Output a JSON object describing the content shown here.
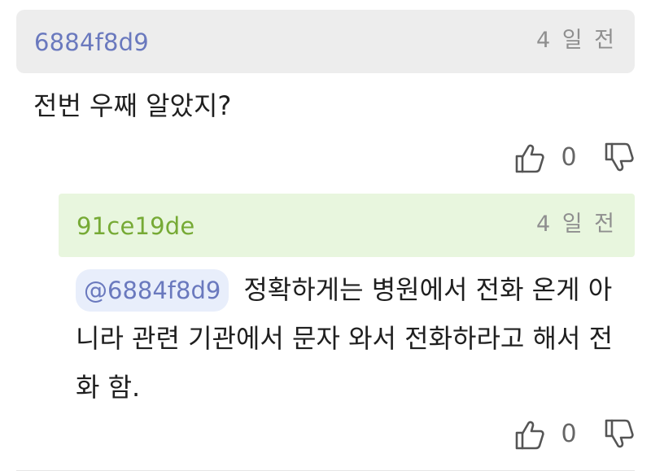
{
  "comment": {
    "author": "6884f8d9",
    "time": "4 일 전",
    "text": "전번 우째 알았지?",
    "likes": "0",
    "icons": {
      "like": "thumbs-up-icon",
      "dislike": "thumbs-down-icon"
    }
  },
  "reply": {
    "author": "91ce19de",
    "time": "4 일 전",
    "mention": "@6884f8d9",
    "text": "정확하게는 병원에서 전화 온게 아니라 관련 기관에서 문자 와서 전화하라고 해서 전화 함.",
    "likes": "0"
  },
  "colors": {
    "comment_header_bg": "#ededed",
    "reply_header_bg": "#e8f6de",
    "comment_author": "#6a79be",
    "reply_author": "#76aa35",
    "mention_bg": "#e8eefb",
    "time": "#8f8f8f"
  }
}
